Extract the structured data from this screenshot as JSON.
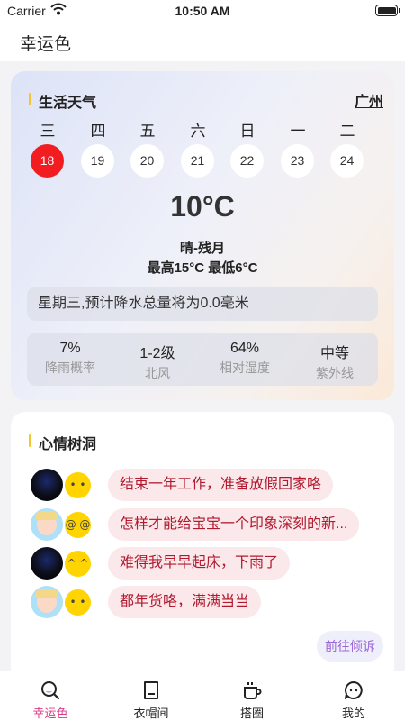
{
  "status_bar": {
    "carrier": "Carrier",
    "time": "10:50 AM"
  },
  "header": {
    "title": "幸运色"
  },
  "weather": {
    "title": "生活天气",
    "city": "广州",
    "days": [
      {
        "weekday": "三",
        "date": "18",
        "selected": true
      },
      {
        "weekday": "四",
        "date": "19",
        "selected": false
      },
      {
        "weekday": "五",
        "date": "20",
        "selected": false
      },
      {
        "weekday": "六",
        "date": "21",
        "selected": false
      },
      {
        "weekday": "日",
        "date": "22",
        "selected": false
      },
      {
        "weekday": "一",
        "date": "23",
        "selected": false
      },
      {
        "weekday": "二",
        "date": "24",
        "selected": false
      }
    ],
    "temperature": "10°C",
    "condition": "晴-残月",
    "high_low": "最高15°C 最低6°C",
    "forecast": "星期三,预计降水总量将为0.0毫米",
    "stats": [
      {
        "value": "7%",
        "label": "降雨概率"
      },
      {
        "value": "1-2级",
        "label": "北风"
      },
      {
        "value": "64%",
        "label": "相对湿度"
      },
      {
        "value": "中等",
        "label": "紫外线"
      }
    ]
  },
  "mood": {
    "title": "心情树洞",
    "messages": [
      {
        "avatar": "dark-avatar",
        "emoji": "smile-emoji",
        "emoji_glyph": "• •",
        "text": "结束一年工作，准备放假回家咯"
      },
      {
        "avatar": "baby-avatar",
        "emoji": "dizzy-emoji",
        "emoji_glyph": "@ @",
        "text": "怎样才能给宝宝一个印象深刻的新..."
      },
      {
        "avatar": "dark-avatar",
        "emoji": "grin-emoji",
        "emoji_glyph": "^ ^",
        "text": "难得我早早起床，下雨了"
      },
      {
        "avatar": "baby-avatar",
        "emoji": "smile-emoji",
        "emoji_glyph": "• •",
        "text": "都年货咯，满满当当"
      }
    ],
    "go_button": "前往倾诉"
  },
  "tabs": [
    {
      "label": "幸运色",
      "icon": "search-icon",
      "active": true
    },
    {
      "label": "衣帽间",
      "icon": "wardrobe-icon",
      "active": false
    },
    {
      "label": "搭圈",
      "icon": "cup-icon",
      "active": false
    },
    {
      "label": "我的",
      "icon": "chat-icon",
      "active": false
    }
  ],
  "colors": {
    "accent": "#f21d21",
    "tab_active": "#d83b86",
    "bubble_text": "#b11a2e",
    "bubble_bg": "#fbe8ea",
    "title_bar": "#f5c430"
  }
}
